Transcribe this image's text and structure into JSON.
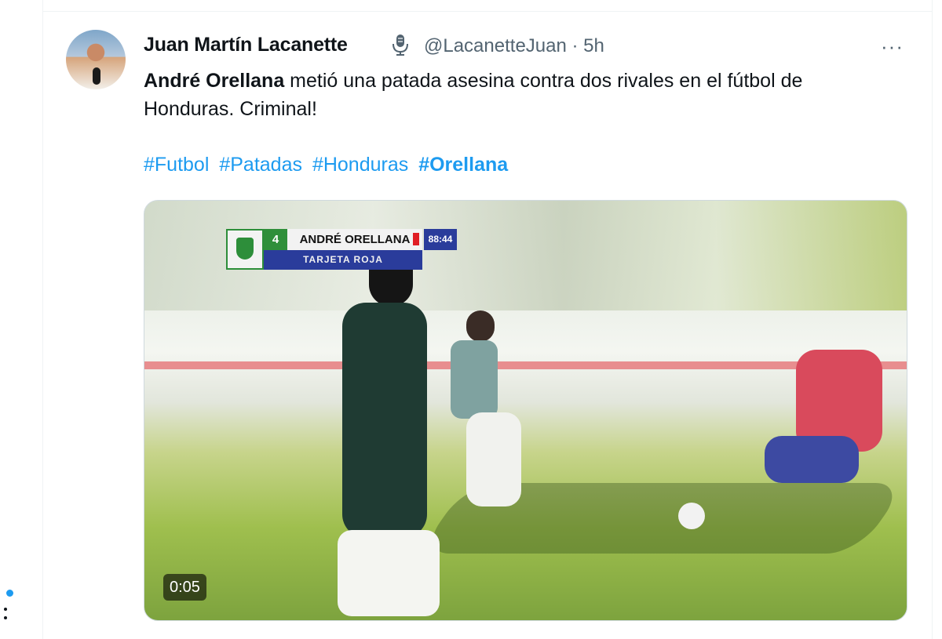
{
  "tweet": {
    "author_name": "Juan Martín Lacanette",
    "author_handle": "@LacanetteJuan",
    "time_separator": "·",
    "time_ago": "5h",
    "body_bold": "André Orellana",
    "body_rest": " metió una patada asesina contra dos rivales en el fútbol de Honduras. Criminal!",
    "hashtags": [
      "#Futbol",
      "#Patadas",
      "#Honduras",
      "#Orellana"
    ],
    "more_label": "···"
  },
  "media": {
    "scorebug_number": "4",
    "scorebug_name": "ANDRÉ ORELLANA",
    "scorebug_time": "88:44",
    "scorebug_sub": "TARJETA ROJA",
    "video_duration": "0:05"
  },
  "colors": {
    "link": "#1d9bf0",
    "muted": "#536471",
    "red_card": "#e01d24"
  },
  "icons": {
    "podcast": "microphone-icon",
    "more": "more-icon"
  }
}
